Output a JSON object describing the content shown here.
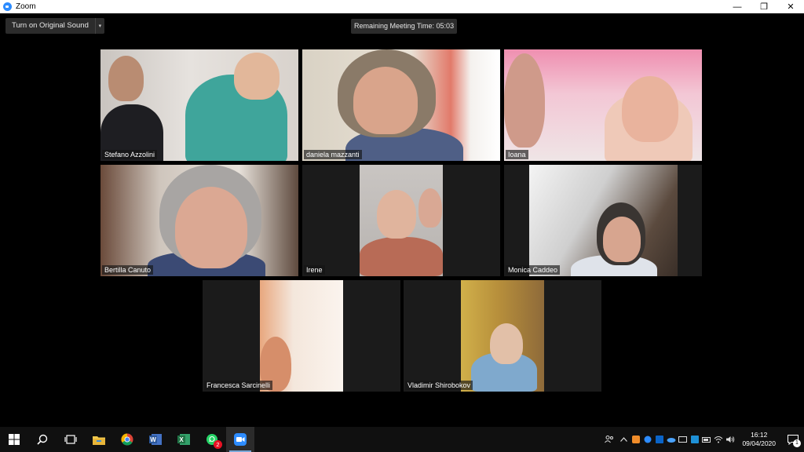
{
  "window": {
    "title": "Zoom",
    "controls": {
      "minimize": "—",
      "restore": "❐",
      "close": "✕"
    }
  },
  "toolbar": {
    "original_sound_label": "Turn on Original Sound",
    "dropdown_glyph": "▾",
    "remaining_time": "Remaining Meeting Time: 05:03"
  },
  "participants": [
    {
      "name": "Stefano Azzolini",
      "active_speaker": true
    },
    {
      "name": "daniela mazzanti"
    },
    {
      "name": "Ioana"
    },
    {
      "name": "Bertilla Canuto"
    },
    {
      "name": "Irene"
    },
    {
      "name": "Monica Caddeo"
    },
    {
      "name": "Francesca Sarcinelli"
    },
    {
      "name": "Vladimir Shirobokov"
    }
  ],
  "taskbar": {
    "apps": [
      "start",
      "search",
      "task-view",
      "file-explorer",
      "chrome",
      "word",
      "excel",
      "whatsapp",
      "zoom"
    ],
    "whatsapp_badge": "2",
    "clock_time": "16:12",
    "clock_date": "09/04/2020",
    "notification_count": "1"
  },
  "colors": {
    "accent": "#2d8cff",
    "active_speaker_border": "#d6d97a"
  }
}
